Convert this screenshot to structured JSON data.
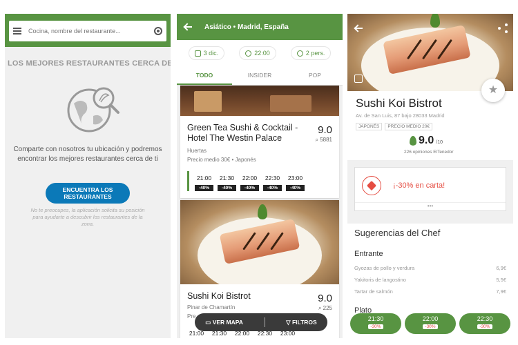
{
  "screen1": {
    "search_placeholder": "Cocina, nombre del restaurante...",
    "heading": "LOS MEJORES RESTAURANTES CERCA DE TI",
    "message": "Comparte con nosotros tu ubicación y podremos encontrar los mejores restaurantes cerca de ti",
    "button_label": "ENCUENTRA LOS RESTAURANTES",
    "note": "No te preocupes, la aplicación solicita su posición para ayudarte a descubrir los restaurantes de la zona."
  },
  "screen2": {
    "title": "Asiático • Madrid, España",
    "filters": {
      "date": "3 dic.",
      "time": "22:00",
      "people": "2 pers."
    },
    "tabs": [
      "TODO",
      "INSIDER",
      "POP"
    ],
    "restaurants": [
      {
        "name": "Green Tea Sushi & Cocktail - Hotel The Westin Palace",
        "score": "9.0",
        "reviews": "5881",
        "area": "Huertas",
        "price": "Precio medio 30€ • Japonés",
        "slots": [
          {
            "time": "21:00",
            "discount": "-40%"
          },
          {
            "time": "21:30",
            "discount": "-40%"
          },
          {
            "time": "22:00",
            "discount": "-40%"
          },
          {
            "time": "22:30",
            "discount": "-40%"
          },
          {
            "time": "23:00",
            "discount": "-40%"
          }
        ]
      },
      {
        "name": "Sushi Koi Bistrot",
        "score": "9.0",
        "reviews": "225",
        "area": "Pinar de Chamartín",
        "price": "Pre",
        "slots": [
          {
            "time": "21:00"
          },
          {
            "time": "21:30"
          },
          {
            "time": "22:00"
          },
          {
            "time": "22:30"
          },
          {
            "time": "23:00"
          }
        ]
      }
    ],
    "map_button": "VER MAPA",
    "filters_button": "FILTROS"
  },
  "screen3": {
    "name": "Sushi Koi Bistrot",
    "address": "Av. de San Luis, 87 bajo 28033 Madrid",
    "tags": [
      "JAPONÉS",
      "PRECIO MEDIO 20€"
    ],
    "rating": "9.0",
    "rating_scale": "/10",
    "opinions": "226 opiniones ElTenedor",
    "promo": "¡-30% en carta!",
    "section": "Sugerencias del Chef",
    "category1": "Entrante",
    "dishes": [
      {
        "name": "Gyozas de pollo y verdura",
        "price": "6,9€"
      },
      {
        "name": "Yakitoris de langostino",
        "price": "5,5€"
      },
      {
        "name": "Tartar de salmón",
        "price": "7,9€"
      }
    ],
    "category2": "Plato",
    "slots": [
      {
        "time": "21:30",
        "discount": "-30%"
      },
      {
        "time": "22:00",
        "discount": "-30%"
      },
      {
        "time": "22:30",
        "discount": "-30%"
      }
    ]
  },
  "colors": {
    "brand_green": "#589442",
    "blue_button": "#0b79b8",
    "promo_red": "#e54d42"
  }
}
